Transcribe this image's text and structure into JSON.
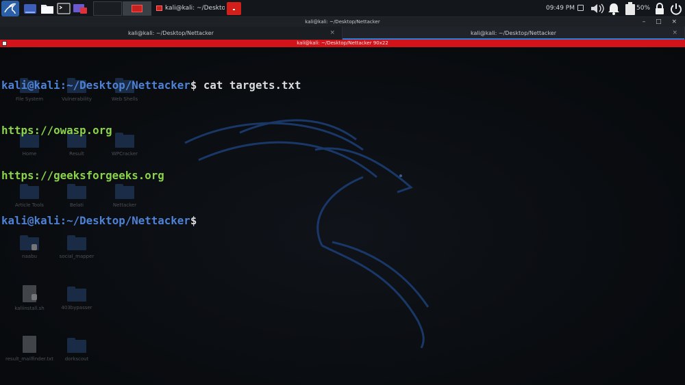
{
  "panel": {
    "workspace_2_task_label": "kali@kali: ~/Desktop/Ne",
    "clock": "09:49 PM",
    "battery_percent": "50%"
  },
  "window": {
    "title": "kali@kali: ~/Desktop/Nettacker",
    "controls": "– □ ×"
  },
  "tabs": [
    {
      "label": "kali@kali: ~/Desktop/Nettacker",
      "active": false
    },
    {
      "label": "kali@kali: ~/Desktop/Nettacker",
      "active": true
    }
  ],
  "terminal": {
    "header": "kali@kali: ~/Desktop/Nettacker 90x22",
    "prompt_user": "kali@kali",
    "prompt_path": ":~/Desktop/Nettacker",
    "prompt_symbol": "$",
    "command": " cat targets.txt",
    "output": [
      "https://owasp.org",
      "https://geeksforgeeks.org"
    ]
  },
  "desktop_icons": [
    {
      "label": "File System"
    },
    {
      "label": "Vulnerability"
    },
    {
      "label": "Web Shells"
    },
    {
      "label": "Home"
    },
    {
      "label": "Result"
    },
    {
      "label": "WPCracker"
    },
    {
      "label": "Article Tools"
    },
    {
      "label": "Belati"
    },
    {
      "label": "Nettacker"
    },
    {
      "label": "naabu"
    },
    {
      "label": "social_mapper"
    },
    {
      "label": "kaliinstall.sh"
    },
    {
      "label": "403bypasser"
    },
    {
      "label": "result_mailfinder.txt"
    },
    {
      "label": "dorkscout"
    }
  ],
  "colors": {
    "accent": "#2f7bd8",
    "terminal_header": "#d2141a",
    "prompt": "#4e82d6",
    "output": "#8ad34a"
  }
}
